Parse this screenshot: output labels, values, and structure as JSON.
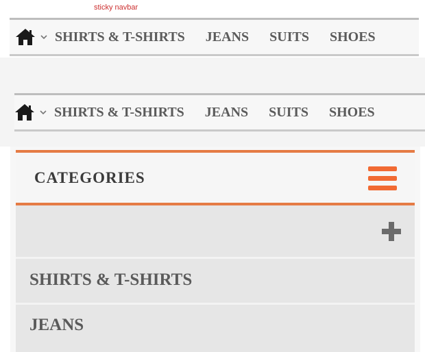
{
  "caption": "sticky navbar",
  "navbar_sticky": {
    "home_icon": "home-icon",
    "dropdown_icon": "chevron-down-icon",
    "links": [
      "SHIRTS & T-SHIRTS",
      "JEANS",
      "SUITS",
      "SHOES"
    ]
  },
  "navbar": {
    "home_icon": "home-icon",
    "dropdown_icon": "chevron-down-icon",
    "links": [
      "SHIRTS & T-SHIRTS",
      "JEANS",
      "SUITS",
      "SHOES"
    ]
  },
  "categories": {
    "title": "CATEGORIES",
    "menu_icon": "hamburger-menu-icon",
    "expand_icon": "plus-icon",
    "items": [
      "SHIRTS & T-SHIRTS",
      "JEANS"
    ]
  },
  "colors": {
    "accent": "#e57b45",
    "hamburger": "#f16a33",
    "nav_text": "#5b5b5b",
    "item_bg": "#e6e6e6"
  }
}
